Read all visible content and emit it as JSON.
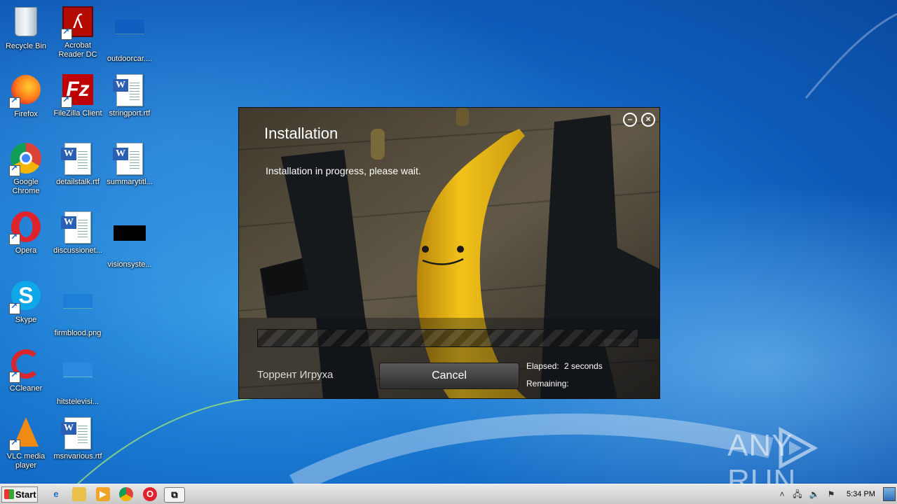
{
  "desktop": {
    "icons": [
      {
        "label": "Recycle Bin"
      },
      {
        "label": "Acrobat Reader DC"
      },
      {
        "label": "outdoorcar...."
      },
      {
        "label": "Firefox"
      },
      {
        "label": "FileZilla Client"
      },
      {
        "label": "stringport.rtf"
      },
      {
        "label": "Google Chrome"
      },
      {
        "label": "detailstalk.rtf"
      },
      {
        "label": "summarytitl..."
      },
      {
        "label": "Opera"
      },
      {
        "label": "discussionet..."
      },
      {
        "label": "visionsyste..."
      },
      {
        "label": "Skype"
      },
      {
        "label": "firmblood.png"
      },
      {
        "label": "CCleaner"
      },
      {
        "label": "hitstelevisi..."
      },
      {
        "label": "VLC media player"
      },
      {
        "label": "msnvarious.rtf"
      }
    ]
  },
  "installer": {
    "title": "Installation",
    "message": "Installation in progress, please wait.",
    "progress": 0,
    "brand": "Торрент Игруха",
    "cancel_label": "Cancel",
    "elapsed_label": "Elapsed:",
    "elapsed_value": "2 seconds",
    "remaining_label": "Remaining:",
    "minimize_icon": "minus",
    "close_icon": "x"
  },
  "watermark": {
    "text_left": "ANY",
    "text_right": "RUN"
  },
  "taskbar": {
    "start_label": "Start",
    "clock": "5:34 PM"
  }
}
